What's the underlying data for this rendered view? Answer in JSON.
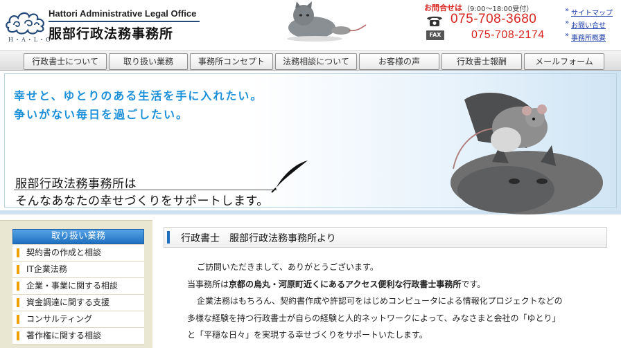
{
  "header": {
    "logo_mark": "H・A・L・O",
    "logo_en": "Hattori Administrative Legal Office",
    "logo_jp": "服部行政法務事務所",
    "contact_label": "お問合せは",
    "contact_hours": "（9:00～18:00受付）",
    "tel": "075-708-3680",
    "fax_label": "FAX",
    "fax": "075-708-2174",
    "util_links": [
      "サイトマップ",
      "お問い合せ",
      "事務所概要"
    ]
  },
  "nav": {
    "tabs": [
      "行政書士について",
      "取り扱い業務",
      "事務所コンセプト",
      "法務相談について",
      "お客様の声",
      "行政書士報酬",
      "メールフォーム"
    ]
  },
  "hero": {
    "line1": "幸せと、ゆとりのある生活を手に入れたい。",
    "line2": "争いがない毎日を過ごしたい。",
    "msg1": "服部行政法務事務所は",
    "msg2": "そんなあなたの幸せづくりをサポートします。"
  },
  "sidebar": {
    "title": "取り扱い業務",
    "items": [
      "契約書の作成と相談",
      "IT企業法務",
      "企業・事業に関する相談",
      "資金調達に関する支援",
      "コンサルティング",
      "著作権に関する相談"
    ]
  },
  "main": {
    "heading": "行政書士　服部行政法務事務所より",
    "p1": "ご訪問いただきまして、ありがとうございます。",
    "p2_pre": "当事務所は",
    "p2_bold": "京都の烏丸・河原町近くにあるアクセス便利な行政書士事務所",
    "p2_post": "です。",
    "p3": "企業法務はもちろん、契約書作成や許認可をはじめコンピュータによる情報化プロジェクトなどの",
    "p4": "多様な経験を持つ行政書士が自らの経験と人的ネットワークによって、みなさまと会社の「ゆとり」",
    "p5": "と「平穏な日々」を実現する幸せづくりをサポートいたします。"
  },
  "colors": {
    "accent_red": "#d8261f",
    "hero_blue": "#1b8fd8",
    "nav_border": "#8f8f8f",
    "sidebar_bg": "#e9e6d2",
    "sidebar_head": "#1f6fc0",
    "bullet": "#f0a000"
  }
}
